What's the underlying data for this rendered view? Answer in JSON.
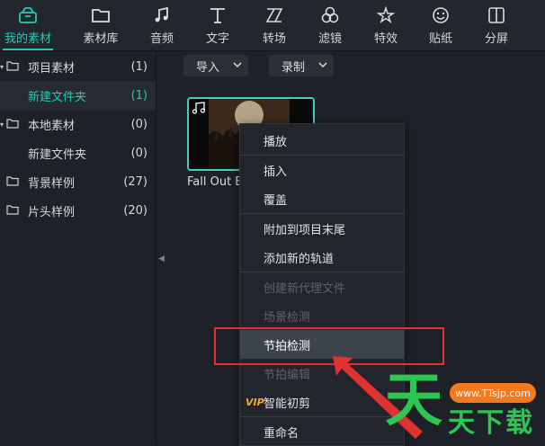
{
  "top_tabs": [
    {
      "label": "我的素材",
      "icon": "media-box-icon",
      "active": true
    },
    {
      "label": "素材库",
      "icon": "folder-icon"
    },
    {
      "label": "音频",
      "icon": "music-note-icon"
    },
    {
      "label": "文字",
      "icon": "text-icon"
    },
    {
      "label": "转场",
      "icon": "transition-icon"
    },
    {
      "label": "滤镜",
      "icon": "filter-icon"
    },
    {
      "label": "特效",
      "icon": "effects-icon"
    },
    {
      "label": "贴纸",
      "icon": "sticker-icon"
    },
    {
      "label": "分屏",
      "icon": "split-screen-icon"
    }
  ],
  "sidebar": {
    "items": [
      {
        "name": "项目素材",
        "count": "(1)",
        "expanded": true
      },
      {
        "name": "新建文件夹",
        "count": "(1)",
        "selected": true
      },
      {
        "name": "本地素材",
        "count": "(0)",
        "expanded": true
      },
      {
        "name": "新建文件夹",
        "count": "(0)"
      },
      {
        "name": "背景样例",
        "count": "(27)"
      },
      {
        "name": "片头样例",
        "count": "(20)"
      }
    ]
  },
  "toolbar": {
    "import_label": "导入",
    "record_label": "录制"
  },
  "media": {
    "clip_label": "Fall Out B"
  },
  "context_menu": {
    "items": [
      {
        "label": "播放",
        "enabled": true
      },
      {
        "label": "插入",
        "enabled": true
      },
      {
        "label": "覆盖",
        "enabled": true
      },
      {
        "label": "附加到项目末尾",
        "enabled": true
      },
      {
        "label": "添加新的轨道",
        "enabled": true
      },
      {
        "label": "创建新代理文件",
        "enabled": false
      },
      {
        "label": "场景检测",
        "enabled": false
      },
      {
        "label": "节拍检测",
        "enabled": true,
        "hovered": true
      },
      {
        "label": "节拍编辑",
        "enabled": false
      },
      {
        "label": "智能初剪",
        "enabled": true,
        "badge": "VIP"
      },
      {
        "label": "重命名",
        "enabled": true
      }
    ]
  },
  "watermark": {
    "url": "www.TTsjp.com",
    "big": "天",
    "small": "天下载"
  },
  "colors": {
    "accent": "#28c7b5",
    "highlight_red": "#e0322f",
    "vip": "#f5a623",
    "watermark_green": "#2dc653",
    "watermark_orange": "#f47a20"
  }
}
